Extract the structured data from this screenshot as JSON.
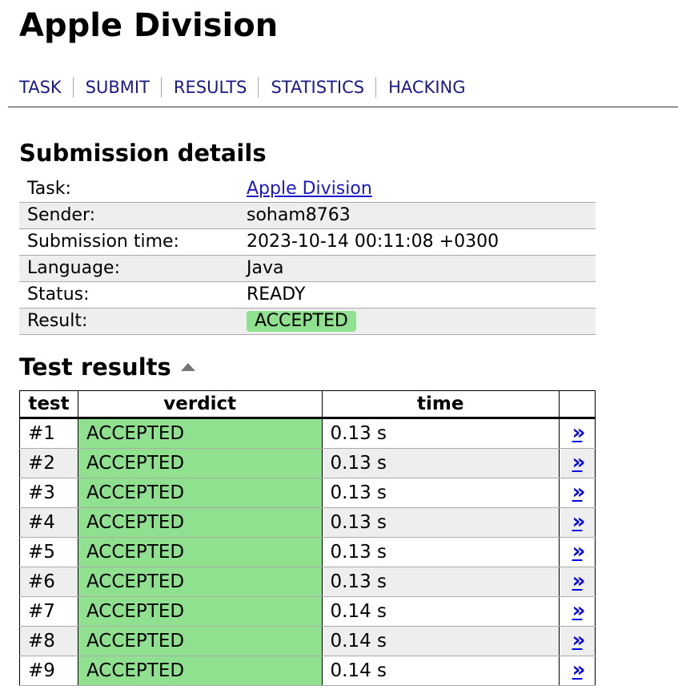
{
  "page": {
    "title": "Apple Division"
  },
  "nav": {
    "items": [
      {
        "label": "TASK"
      },
      {
        "label": "SUBMIT"
      },
      {
        "label": "RESULTS"
      },
      {
        "label": "STATISTICS"
      },
      {
        "label": "HACKING"
      }
    ]
  },
  "details": {
    "heading": "Submission details",
    "rows": {
      "task": {
        "label": "Task:",
        "value": "Apple Division"
      },
      "sender": {
        "label": "Sender:",
        "value": "soham8763"
      },
      "time": {
        "label": "Submission time:",
        "value": "2023-10-14 00:11:08 +0300"
      },
      "language": {
        "label": "Language:",
        "value": "Java"
      },
      "status": {
        "label": "Status:",
        "value": "READY"
      },
      "result": {
        "label": "Result:",
        "value": "ACCEPTED"
      }
    }
  },
  "tests": {
    "heading": "Test results",
    "columns": {
      "test": "test",
      "verdict": "verdict",
      "time": "time"
    },
    "link_glyph": "»",
    "rows": [
      {
        "test": "#1",
        "verdict": "ACCEPTED",
        "time": "0.13 s"
      },
      {
        "test": "#2",
        "verdict": "ACCEPTED",
        "time": "0.13 s"
      },
      {
        "test": "#3",
        "verdict": "ACCEPTED",
        "time": "0.13 s"
      },
      {
        "test": "#4",
        "verdict": "ACCEPTED",
        "time": "0.13 s"
      },
      {
        "test": "#5",
        "verdict": "ACCEPTED",
        "time": "0.13 s"
      },
      {
        "test": "#6",
        "verdict": "ACCEPTED",
        "time": "0.13 s"
      },
      {
        "test": "#7",
        "verdict": "ACCEPTED",
        "time": "0.14 s"
      },
      {
        "test": "#8",
        "verdict": "ACCEPTED",
        "time": "0.14 s"
      },
      {
        "test": "#9",
        "verdict": "ACCEPTED",
        "time": "0.14 s"
      }
    ]
  },
  "colors": {
    "accepted": "#8fe08f",
    "link": "#1a1acc",
    "nav_link": "#1a1a8c",
    "row_alt": "#eeeeee"
  }
}
